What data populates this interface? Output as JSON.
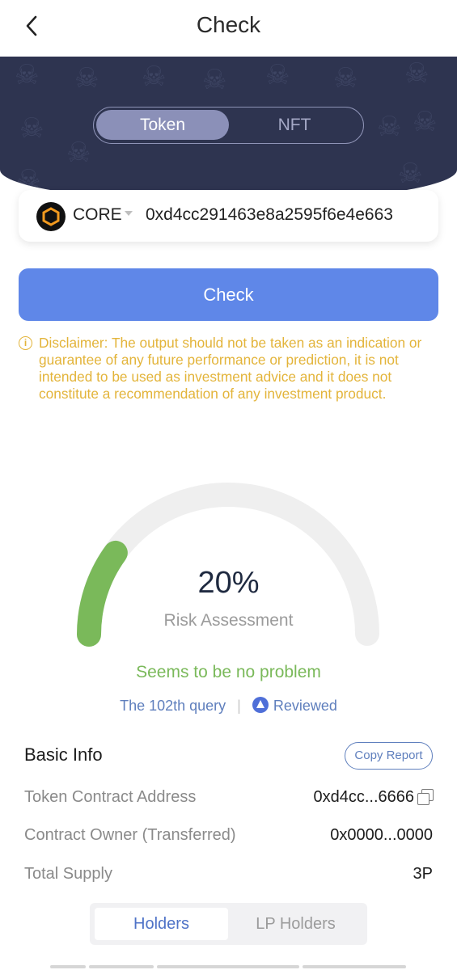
{
  "header": {
    "title": "Check",
    "back_icon": "chevron-left-icon"
  },
  "mode_tabs": {
    "token_label": "Token",
    "nft_label": "NFT",
    "selected": "Token"
  },
  "address_bar": {
    "chain_name": "CORE",
    "chain_icon": "hexagon-logo-icon",
    "address_value": "0xd4cc291463e8a2595f6e4e663"
  },
  "check_button": {
    "label": "Check"
  },
  "disclaimer": {
    "text": "Disclaimer: The output should not be taken as an indication or guarantee of any future performance or prediction, it is not intended to be used as investment advice and it does not constitute a recommendation of any investment product.",
    "color": "#e3b43a"
  },
  "risk": {
    "percent_text": "20%",
    "percent_value": 20,
    "label": "Risk Assessment",
    "status": "Seems to be no problem",
    "gauge_color": "#7ab95a"
  },
  "meta": {
    "query_text": "The 102th query",
    "separator": "|",
    "reviewed_label": "Reviewed"
  },
  "basic_info": {
    "title": "Basic Info",
    "copy_report_label": "Copy Report",
    "rows": [
      {
        "key": "Token Contract Address",
        "value": "0xd4cc...6666"
      },
      {
        "key": "Contract Owner (Transferred)",
        "value": "0x0000...0000"
      },
      {
        "key": "Total Supply",
        "value": "3P"
      }
    ]
  },
  "holder_tabs": {
    "holders_label": "Holders",
    "lp_holders_label": "LP Holders",
    "selected": "Holders"
  },
  "colors": {
    "accent_blue": "#5f87e8",
    "hero_bg": "#2e3450",
    "success_green": "#7ab95a"
  }
}
